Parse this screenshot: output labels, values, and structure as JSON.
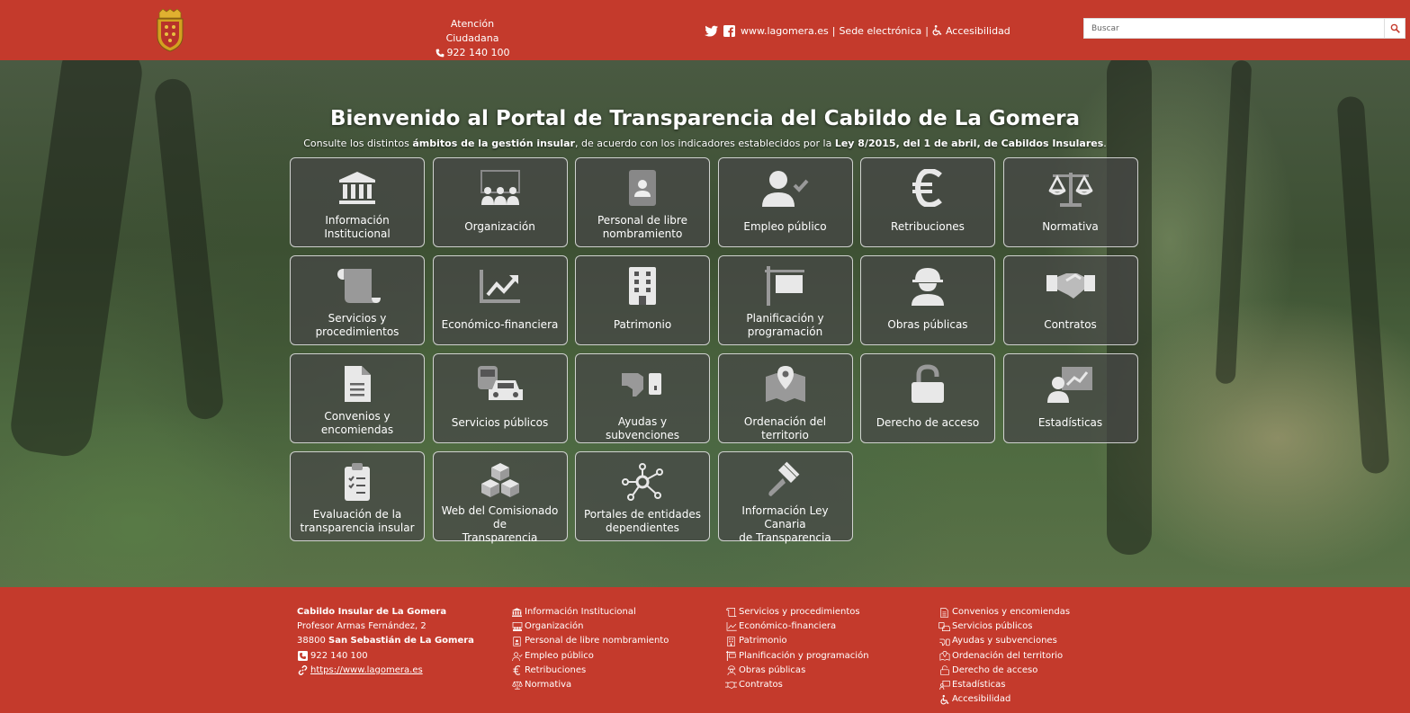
{
  "header": {
    "atencion_title": "Atención Ciudadana",
    "atencion_phone": "922 140 100",
    "site_link": "www.lagomera.es",
    "sep1": "|",
    "sede_link": "Sede electrónica",
    "sep2": "|",
    "accesibilidad": "Accesibilidad",
    "search_placeholder": "Buscar"
  },
  "hero": {
    "title": "Bienvenido al Portal de Transparencia del Cabildo de La Gomera",
    "sub_1": "Consulte los distintos ",
    "sub_b1": "ámbitos de la gestión insular",
    "sub_2": ", de acuerdo con los indicadores establecidos por la ",
    "sub_b2": "Ley 8/2015, del 1 de abril, de Cabildos Insulares",
    "sub_3": "."
  },
  "tiles": [
    {
      "l1": "Información",
      "l2": "Institucional",
      "icon": "building-columns-icon"
    },
    {
      "l1": "Organización",
      "l2": "",
      "icon": "people-group-icon"
    },
    {
      "l1": "Personal de libre",
      "l2": "nombramiento",
      "icon": "id-badge-icon"
    },
    {
      "l1": "Empleo público",
      "l2": "",
      "icon": "user-check-icon"
    },
    {
      "l1": "Retribuciones",
      "l2": "",
      "icon": "euro-icon"
    },
    {
      "l1": "Normativa",
      "l2": "",
      "icon": "scale-balanced-icon"
    },
    {
      "l1": "Servicios y",
      "l2": "procedimientos",
      "icon": "scroll-icon"
    },
    {
      "l1": "Económico-financiera",
      "l2": "",
      "icon": "chart-line-icon"
    },
    {
      "l1": "Patrimonio",
      "l2": "",
      "icon": "building-icon"
    },
    {
      "l1": "Planificación y",
      "l2": "programación",
      "icon": "sign-icon"
    },
    {
      "l1": "Obras públicas",
      "l2": "",
      "icon": "helmet-worker-icon"
    },
    {
      "l1": "Contratos",
      "l2": "",
      "icon": "handshake-icon"
    },
    {
      "l1": "Convenios y",
      "l2": "encomiendas",
      "icon": "file-lines-icon"
    },
    {
      "l1": "Servicios públicos",
      "l2": "",
      "icon": "bus-car-icon"
    },
    {
      "l1": "Ayudas y subvenciones",
      "l2": "",
      "icon": "hand-coin-icon"
    },
    {
      "l1": "Ordenación del territorio",
      "l2": "",
      "icon": "map-pin-icon"
    },
    {
      "l1": "Derecho de acceso",
      "l2": "",
      "icon": "lock-open-icon"
    },
    {
      "l1": "Estadísticas",
      "l2": "",
      "icon": "chalkboard-user-icon"
    },
    {
      "l1": "Evaluación de la",
      "l2": "transparencia insular",
      "icon": "clipboard-check-icon"
    },
    {
      "l1": "Web del Comisionado de",
      "l2": "Transparencia",
      "icon": "cubes-icon"
    },
    {
      "l1": "Portales de entidades",
      "l2": "dependientes",
      "icon": "network-icon"
    },
    {
      "l1": "Información Ley Canaria",
      "l2": "de Transparencia",
      "icon": "gavel-icon"
    }
  ],
  "footer": {
    "name": "Cabildo Insular de La Gomera",
    "street": "Profesor Armas Fernández, 2",
    "postal": "38800 ",
    "city": "San Sebastián de La Gomera",
    "phone": "922 140 100",
    "web": "https://www.lagomera.es",
    "col2": [
      "Información Institucional",
      "Organización",
      "Personal de libre nombramiento",
      "Empleo público",
      "Retribuciones",
      "Normativa"
    ],
    "col3": [
      "Servicios y procedimientos",
      "Económico-financiera",
      "Patrimonio",
      "Planificación y programación",
      "Obras públicas",
      "Contratos"
    ],
    "col4": [
      "Convenios y encomiendas",
      "Servicios públicos",
      "Ayudas y subvenciones",
      "Ordenación del territorio",
      "Derecho de acceso",
      "Estadísticas",
      "Accesibilidad"
    ]
  }
}
